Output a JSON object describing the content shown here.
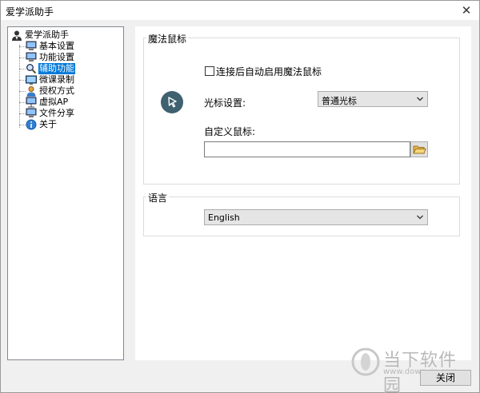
{
  "window": {
    "title": "爱学派助手",
    "close_glyph": "✕"
  },
  "tree": {
    "root": "爱学派助手",
    "items": [
      {
        "label": "基本设置",
        "icon": "computer-icon"
      },
      {
        "label": "功能设置",
        "icon": "computer-icon"
      },
      {
        "label": "辅助功能",
        "icon": "magnifier-icon",
        "selected": true
      },
      {
        "label": "微课录制",
        "icon": "monitor-icon"
      },
      {
        "label": "授权方式",
        "icon": "user-icon"
      },
      {
        "label": "虚拟AP",
        "icon": "network-icon"
      },
      {
        "label": "文件分享",
        "icon": "computer-icon"
      },
      {
        "label": "关于",
        "icon": "info-icon"
      }
    ]
  },
  "magic_mouse": {
    "group_title": "魔法鼠标",
    "auto_enable_label": "连接后自动启用魔法鼠标",
    "auto_enable_checked": false,
    "cursor_setting_label": "光标设置:",
    "cursor_setting_value": "普通光标",
    "custom_cursor_label": "自定义鼠标:",
    "custom_cursor_value": ""
  },
  "language": {
    "group_title": "语言",
    "value": "English"
  },
  "footer": {
    "close_label": "关闭"
  },
  "watermark": {
    "brand": "当下软件园",
    "url": "www.downxia.com"
  },
  "colors": {
    "selection": "#0078d7",
    "cursor_badge": "#3f6170",
    "watermark": "#b9b9b9"
  }
}
